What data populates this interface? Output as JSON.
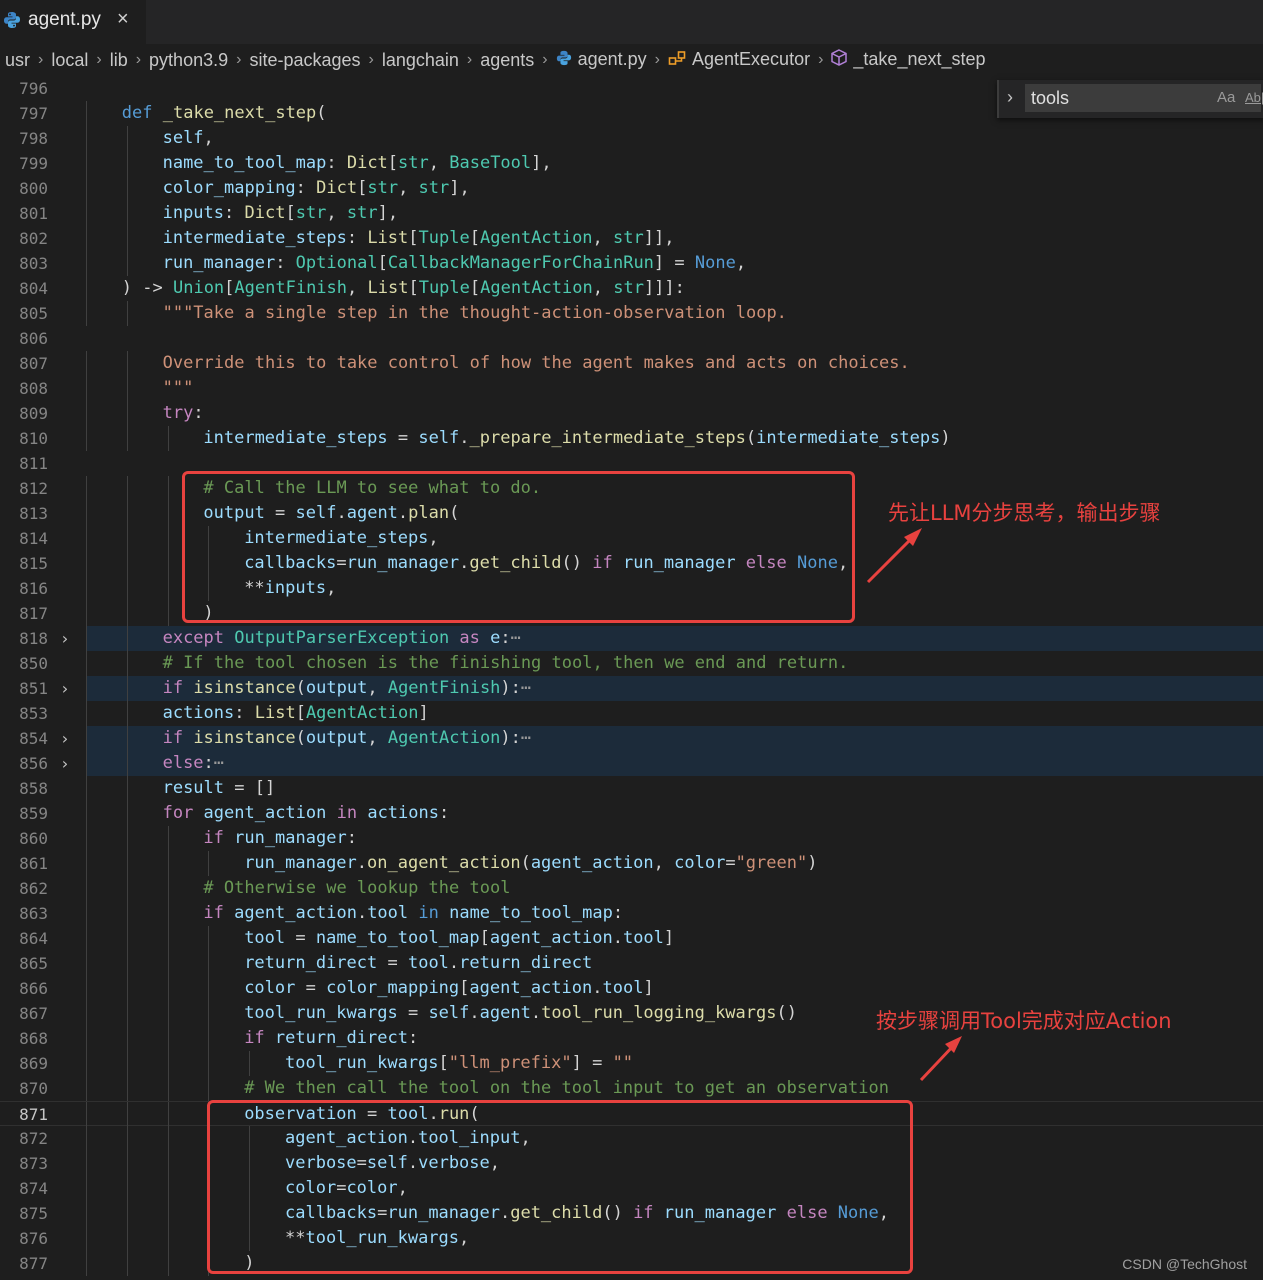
{
  "tab": {
    "filename": "agent.py",
    "close_glyph": "×"
  },
  "breadcrumb": [
    {
      "label": "usr"
    },
    {
      "label": "local"
    },
    {
      "label": "lib"
    },
    {
      "label": "python3.9"
    },
    {
      "label": "site-packages"
    },
    {
      "label": "langchain"
    },
    {
      "label": "agents"
    },
    {
      "label": "agent.py",
      "icon": "python-file-icon"
    },
    {
      "label": "AgentExecutor",
      "icon": "class-icon"
    },
    {
      "label": "_take_next_step",
      "icon": "method-icon"
    }
  ],
  "find_widget": {
    "query": "tools",
    "match_case_label": "Aa",
    "whole_word_label": "Ab|"
  },
  "code_lines": [
    {
      "n": "796",
      "indent": 0,
      "tokens": []
    },
    {
      "n": "797",
      "indent": 1,
      "tokens": [
        [
          "def ",
          "kw"
        ],
        [
          "_take_next_step",
          "fn"
        ],
        [
          "(",
          ""
        ]
      ]
    },
    {
      "n": "798",
      "indent": 2,
      "tokens": [
        [
          "self",
          "var"
        ],
        [
          ",",
          ""
        ]
      ]
    },
    {
      "n": "799",
      "indent": 2,
      "tokens": [
        [
          "name_to_tool_map",
          "var"
        ],
        [
          ": ",
          ""
        ],
        [
          "Dict",
          "fn"
        ],
        [
          "[",
          ""
        ],
        [
          "str",
          "typ"
        ],
        [
          ", ",
          ""
        ],
        [
          "BaseTool",
          "typ"
        ],
        [
          "],",
          ""
        ]
      ]
    },
    {
      "n": "800",
      "indent": 2,
      "tokens": [
        [
          "color_mapping",
          "var"
        ],
        [
          ": ",
          ""
        ],
        [
          "Dict",
          "fn"
        ],
        [
          "[",
          ""
        ],
        [
          "str",
          "typ"
        ],
        [
          ", ",
          ""
        ],
        [
          "str",
          "typ"
        ],
        [
          "],",
          ""
        ]
      ]
    },
    {
      "n": "801",
      "indent": 2,
      "tokens": [
        [
          "inputs",
          "var"
        ],
        [
          ": ",
          ""
        ],
        [
          "Dict",
          "fn"
        ],
        [
          "[",
          ""
        ],
        [
          "str",
          "typ"
        ],
        [
          ", ",
          ""
        ],
        [
          "str",
          "typ"
        ],
        [
          "],",
          ""
        ]
      ]
    },
    {
      "n": "802",
      "indent": 2,
      "tokens": [
        [
          "intermediate_steps",
          "var"
        ],
        [
          ": ",
          ""
        ],
        [
          "List",
          "fn"
        ],
        [
          "[",
          ""
        ],
        [
          "Tuple",
          "typ"
        ],
        [
          "[",
          ""
        ],
        [
          "AgentAction",
          "typ"
        ],
        [
          ", ",
          ""
        ],
        [
          "str",
          "typ"
        ],
        [
          "]],",
          ""
        ]
      ]
    },
    {
      "n": "803",
      "indent": 2,
      "tokens": [
        [
          "run_manager",
          "var"
        ],
        [
          ": ",
          ""
        ],
        [
          "Optional",
          "typ"
        ],
        [
          "[",
          ""
        ],
        [
          "CallbackManagerForChainRun",
          "typ"
        ],
        [
          "] = ",
          ""
        ],
        [
          "None",
          "kw"
        ],
        [
          ",",
          ""
        ]
      ]
    },
    {
      "n": "804",
      "indent": 1,
      "tokens": [
        [
          ") -> ",
          ""
        ],
        [
          "Union",
          "typ"
        ],
        [
          "[",
          ""
        ],
        [
          "AgentFinish",
          "typ"
        ],
        [
          ", ",
          ""
        ],
        [
          "List",
          "fn"
        ],
        [
          "[",
          ""
        ],
        [
          "Tuple",
          "typ"
        ],
        [
          "[",
          ""
        ],
        [
          "AgentAction",
          "typ"
        ],
        [
          ", ",
          ""
        ],
        [
          "str",
          "typ"
        ],
        [
          "]]]:",
          ""
        ]
      ]
    },
    {
      "n": "805",
      "indent": 2,
      "tokens": [
        [
          "\"\"\"Take a single step in the thought-action-observation loop.",
          "str"
        ]
      ]
    },
    {
      "n": "806",
      "indent": 0,
      "tokens": []
    },
    {
      "n": "807",
      "indent": 2,
      "tokens": [
        [
          "Override this to take control of how the agent makes and acts on choices.",
          "str"
        ]
      ]
    },
    {
      "n": "808",
      "indent": 2,
      "tokens": [
        [
          "\"\"\"",
          "str"
        ]
      ]
    },
    {
      "n": "809",
      "indent": 2,
      "tokens": [
        [
          "try",
          "ctl"
        ],
        [
          ":",
          ""
        ]
      ]
    },
    {
      "n": "810",
      "indent": 3,
      "tokens": [
        [
          "intermediate_steps",
          "var"
        ],
        [
          " = ",
          ""
        ],
        [
          "self",
          "var"
        ],
        [
          ".",
          ""
        ],
        [
          "_prepare_intermediate_steps",
          "fn"
        ],
        [
          "(",
          ""
        ],
        [
          "intermediate_steps",
          "var"
        ],
        [
          ")",
          ""
        ]
      ]
    },
    {
      "n": "811",
      "indent": 0,
      "tokens": []
    },
    {
      "n": "812",
      "indent": 3,
      "tokens": [
        [
          "# Call the LLM to see what to do.",
          "cmt"
        ]
      ]
    },
    {
      "n": "813",
      "indent": 3,
      "tokens": [
        [
          "output",
          "var"
        ],
        [
          " = ",
          ""
        ],
        [
          "self",
          "var"
        ],
        [
          ".",
          ""
        ],
        [
          "agent",
          "var"
        ],
        [
          ".",
          ""
        ],
        [
          "plan",
          "fn"
        ],
        [
          "(",
          ""
        ]
      ]
    },
    {
      "n": "814",
      "indent": 4,
      "tokens": [
        [
          "intermediate_steps",
          "var"
        ],
        [
          ",",
          ""
        ]
      ]
    },
    {
      "n": "815",
      "indent": 4,
      "tokens": [
        [
          "callbacks",
          "var"
        ],
        [
          "=",
          ""
        ],
        [
          "run_manager",
          "var"
        ],
        [
          ".",
          ""
        ],
        [
          "get_child",
          "fn"
        ],
        [
          "() ",
          ""
        ],
        [
          "if ",
          "ctl"
        ],
        [
          "run_manager ",
          "var"
        ],
        [
          "else ",
          "ctl"
        ],
        [
          "None",
          "kw"
        ],
        [
          ",",
          ""
        ]
      ]
    },
    {
      "n": "816",
      "indent": 4,
      "tokens": [
        [
          "**",
          ""
        ],
        [
          "inputs",
          "var"
        ],
        [
          ",",
          ""
        ]
      ]
    },
    {
      "n": "817",
      "indent": 3,
      "tokens": [
        [
          ")",
          ""
        ]
      ]
    },
    {
      "n": "818",
      "indent": 2,
      "folded": true,
      "tokens": [
        [
          "except ",
          "ctl"
        ],
        [
          "OutputParserException ",
          "typ"
        ],
        [
          "as ",
          "ctl"
        ],
        [
          "e",
          "var"
        ],
        [
          ":",
          ""
        ],
        [
          "⋯",
          "ellip"
        ]
      ]
    },
    {
      "n": "850",
      "indent": 2,
      "tokens": [
        [
          "# If the tool chosen is the finishing tool, then we end and return.",
          "cmt"
        ]
      ]
    },
    {
      "n": "851",
      "indent": 2,
      "folded": true,
      "tokens": [
        [
          "if ",
          "ctl"
        ],
        [
          "isinstance",
          "fn"
        ],
        [
          "(",
          ""
        ],
        [
          "output",
          "var"
        ],
        [
          ", ",
          ""
        ],
        [
          "AgentFinish",
          "typ"
        ],
        [
          "):",
          ""
        ],
        [
          "⋯",
          "ellip"
        ]
      ]
    },
    {
      "n": "853",
      "indent": 2,
      "tokens": [
        [
          "actions",
          "var"
        ],
        [
          ": ",
          ""
        ],
        [
          "List",
          "fn"
        ],
        [
          "[",
          ""
        ],
        [
          "AgentAction",
          "typ"
        ],
        [
          "]",
          ""
        ]
      ]
    },
    {
      "n": "854",
      "indent": 2,
      "folded": true,
      "tokens": [
        [
          "if ",
          "ctl"
        ],
        [
          "isinstance",
          "fn"
        ],
        [
          "(",
          ""
        ],
        [
          "output",
          "var"
        ],
        [
          ", ",
          ""
        ],
        [
          "AgentAction",
          "typ"
        ],
        [
          "):",
          ""
        ],
        [
          "⋯",
          "ellip"
        ]
      ]
    },
    {
      "n": "856",
      "indent": 2,
      "folded": true,
      "tokens": [
        [
          "else",
          "ctl"
        ],
        [
          ":",
          ""
        ],
        [
          "⋯",
          "ellip"
        ]
      ]
    },
    {
      "n": "858",
      "indent": 2,
      "tokens": [
        [
          "result",
          "var"
        ],
        [
          " = []",
          ""
        ]
      ]
    },
    {
      "n": "859",
      "indent": 2,
      "tokens": [
        [
          "for ",
          "ctl"
        ],
        [
          "agent_action ",
          "var"
        ],
        [
          "in ",
          "ctl"
        ],
        [
          "actions",
          "var"
        ],
        [
          ":",
          ""
        ]
      ]
    },
    {
      "n": "860",
      "indent": 3,
      "tokens": [
        [
          "if ",
          "ctl"
        ],
        [
          "run_manager",
          "var"
        ],
        [
          ":",
          ""
        ]
      ]
    },
    {
      "n": "861",
      "indent": 4,
      "tokens": [
        [
          "run_manager",
          "var"
        ],
        [
          ".",
          ""
        ],
        [
          "on_agent_action",
          "fn"
        ],
        [
          "(",
          ""
        ],
        [
          "agent_action",
          "var"
        ],
        [
          ", ",
          ""
        ],
        [
          "color",
          "var"
        ],
        [
          "=",
          ""
        ],
        [
          "\"green\"",
          "str"
        ],
        [
          ")",
          ""
        ]
      ]
    },
    {
      "n": "862",
      "indent": 3,
      "tokens": [
        [
          "# Otherwise we lookup the tool",
          "cmt"
        ]
      ]
    },
    {
      "n": "863",
      "indent": 3,
      "tokens": [
        [
          "if ",
          "ctl"
        ],
        [
          "agent_action",
          "var"
        ],
        [
          ".",
          ""
        ],
        [
          "tool ",
          "var"
        ],
        [
          "in ",
          "kw"
        ],
        [
          "name_to_tool_map",
          "var"
        ],
        [
          ":",
          ""
        ]
      ]
    },
    {
      "n": "864",
      "indent": 4,
      "tokens": [
        [
          "tool",
          "var"
        ],
        [
          " = ",
          ""
        ],
        [
          "name_to_tool_map",
          "var"
        ],
        [
          "[",
          ""
        ],
        [
          "agent_action",
          "var"
        ],
        [
          ".",
          ""
        ],
        [
          "tool",
          "var"
        ],
        [
          "]",
          ""
        ]
      ]
    },
    {
      "n": "865",
      "indent": 4,
      "tokens": [
        [
          "return_direct",
          "var"
        ],
        [
          " = ",
          ""
        ],
        [
          "tool",
          "var"
        ],
        [
          ".",
          ""
        ],
        [
          "return_direct",
          "var"
        ]
      ]
    },
    {
      "n": "866",
      "indent": 4,
      "tokens": [
        [
          "color",
          "var"
        ],
        [
          " = ",
          ""
        ],
        [
          "color_mapping",
          "var"
        ],
        [
          "[",
          ""
        ],
        [
          "agent_action",
          "var"
        ],
        [
          ".",
          ""
        ],
        [
          "tool",
          "var"
        ],
        [
          "]",
          ""
        ]
      ]
    },
    {
      "n": "867",
      "indent": 4,
      "tokens": [
        [
          "tool_run_kwargs",
          "var"
        ],
        [
          " = ",
          ""
        ],
        [
          "self",
          "var"
        ],
        [
          ".",
          ""
        ],
        [
          "agent",
          "var"
        ],
        [
          ".",
          ""
        ],
        [
          "tool_run_logging_kwargs",
          "fn"
        ],
        [
          "()",
          ""
        ]
      ]
    },
    {
      "n": "868",
      "indent": 4,
      "tokens": [
        [
          "if ",
          "ctl"
        ],
        [
          "return_direct",
          "var"
        ],
        [
          ":",
          ""
        ]
      ]
    },
    {
      "n": "869",
      "indent": 5,
      "tokens": [
        [
          "tool_run_kwargs",
          "var"
        ],
        [
          "[",
          ""
        ],
        [
          "\"llm_prefix\"",
          "str"
        ],
        [
          "] = ",
          ""
        ],
        [
          "\"\"",
          "str"
        ]
      ]
    },
    {
      "n": "870",
      "indent": 4,
      "tokens": [
        [
          "# We then call the tool on the tool input to get an observation",
          "cmt"
        ]
      ]
    },
    {
      "n": "871",
      "indent": 4,
      "current": true,
      "tokens": [
        [
          "observation",
          "var"
        ],
        [
          " = ",
          ""
        ],
        [
          "tool",
          "var"
        ],
        [
          ".",
          ""
        ],
        [
          "run",
          "fn"
        ],
        [
          "(",
          ""
        ]
      ]
    },
    {
      "n": "872",
      "indent": 5,
      "tokens": [
        [
          "agent_action",
          "var"
        ],
        [
          ".",
          ""
        ],
        [
          "tool_input",
          "var"
        ],
        [
          ",",
          ""
        ]
      ]
    },
    {
      "n": "873",
      "indent": 5,
      "tokens": [
        [
          "verbose",
          "var"
        ],
        [
          "=",
          ""
        ],
        [
          "self",
          "var"
        ],
        [
          ".",
          ""
        ],
        [
          "verbose",
          "var"
        ],
        [
          ",",
          ""
        ]
      ]
    },
    {
      "n": "874",
      "indent": 5,
      "tokens": [
        [
          "color",
          "var"
        ],
        [
          "=",
          ""
        ],
        [
          "color",
          "var"
        ],
        [
          ",",
          ""
        ]
      ]
    },
    {
      "n": "875",
      "indent": 5,
      "tokens": [
        [
          "callbacks",
          "var"
        ],
        [
          "=",
          ""
        ],
        [
          "run_manager",
          "var"
        ],
        [
          ".",
          ""
        ],
        [
          "get_child",
          "fn"
        ],
        [
          "() ",
          ""
        ],
        [
          "if ",
          "ctl"
        ],
        [
          "run_manager ",
          "var"
        ],
        [
          "else ",
          "ctl"
        ],
        [
          "None",
          "kw"
        ],
        [
          ",",
          ""
        ]
      ]
    },
    {
      "n": "876",
      "indent": 5,
      "tokens": [
        [
          "**",
          ""
        ],
        [
          "tool_run_kwargs",
          "var"
        ],
        [
          ",",
          ""
        ]
      ]
    },
    {
      "n": "877",
      "indent": 4,
      "tokens": [
        [
          ")",
          ""
        ]
      ]
    }
  ],
  "annotations": {
    "top_label": "先让LLM分步思考，输出步骤",
    "bottom_label": "按步骤调用Tool完成对应Action",
    "accent_color": "#e8423f"
  },
  "watermark": "CSDN @TechGhost"
}
